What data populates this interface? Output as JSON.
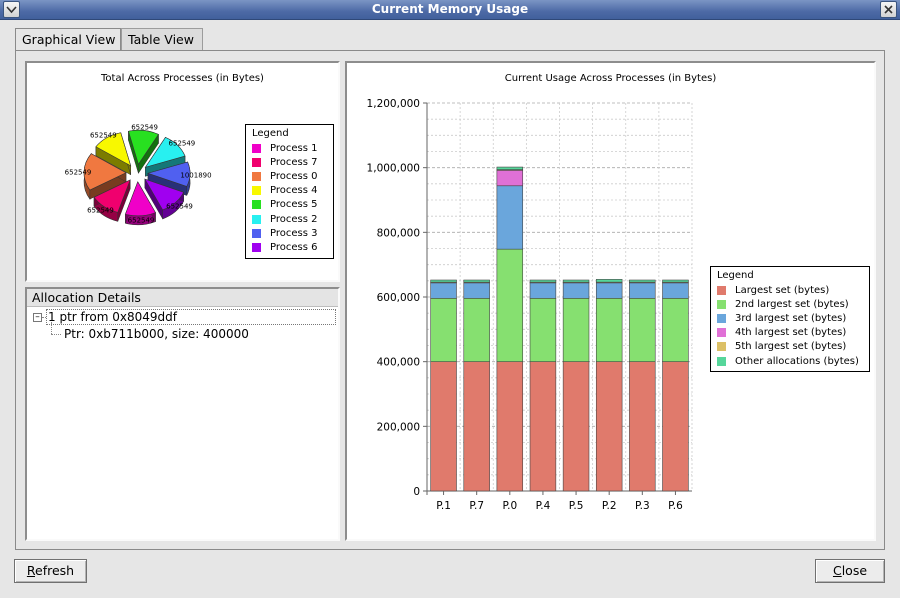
{
  "window": {
    "title": "Current Memory Usage"
  },
  "tabs": [
    {
      "label": "Graphical View",
      "active": true
    },
    {
      "label": "Table View",
      "active": false
    }
  ],
  "pie_chart": {
    "title": "Total Across Processes (in Bytes)",
    "legend_title": "Legend",
    "slice_labels": [
      "652549",
      "652549",
      "652549",
      "652549",
      "652549",
      "652549",
      "1001890",
      "652549"
    ]
  },
  "allocation_details": {
    "title": "Allocation Details",
    "expander": "–",
    "root": "1 ptr from 0x8049ddf",
    "child": "Ptr: 0xb711b000, size: 400000"
  },
  "buttons": {
    "refresh": {
      "label": "efresh",
      "mnemonic": "R"
    },
    "close": {
      "label": "lose",
      "mnemonic": "C"
    }
  },
  "chart_data": [
    {
      "type": "pie",
      "title": "Total Across Processes (in Bytes)",
      "legend_title": "Legend",
      "categories": [
        "Process 1",
        "Process 7",
        "Process 0",
        "Process 4",
        "Process 5",
        "Process 2",
        "Process 3",
        "Process 6"
      ],
      "values": [
        652549,
        652549,
        1001890,
        652549,
        652549,
        652549,
        652549,
        652549
      ],
      "colors": [
        "#f000c8",
        "#f0006e",
        "#f07840",
        "#f8f800",
        "#28e020",
        "#28f0f0",
        "#5060f0",
        "#a000f0"
      ],
      "exploded": true
    },
    {
      "type": "bar",
      "stacked": true,
      "title": "Current Usage Across Processes (in Bytes)",
      "legend_title": "Legend",
      "categories": [
        "P.1",
        "P.7",
        "P.0",
        "P.4",
        "P.5",
        "P.2",
        "P.3",
        "P.6"
      ],
      "ylim": [
        0,
        1200000
      ],
      "yticks": [
        "0",
        "200,000",
        "400,000",
        "600,000",
        "800,000",
        "1,000,000",
        "1,200,000"
      ],
      "ytick_values": [
        0,
        200000,
        400000,
        600000,
        800000,
        1000000,
        1200000
      ],
      "grid": true,
      "legend_position": "right",
      "series": [
        {
          "name": "Largest set (bytes)",
          "color": "#e07a6c",
          "values": [
            400000,
            400000,
            400000,
            400000,
            400000,
            400000,
            400000,
            400000
          ]
        },
        {
          "name": "2nd largest set (bytes)",
          "color": "#86e070",
          "values": [
            196000,
            196000,
            348000,
            196000,
            196000,
            196000,
            196000,
            196000
          ]
        },
        {
          "name": "3rd largest set (bytes)",
          "color": "#6aa6dc",
          "values": [
            48000,
            48000,
            196000,
            48000,
            48000,
            48000,
            48000,
            48000
          ]
        },
        {
          "name": "4th largest set (bytes)",
          "color": "#e070d6",
          "values": [
            0,
            0,
            48000,
            0,
            0,
            0,
            0,
            0
          ]
        },
        {
          "name": "5th largest set (bytes)",
          "color": "#dcc066",
          "values": [
            2000,
            2000,
            2000,
            2000,
            2000,
            2000,
            2000,
            2000
          ]
        },
        {
          "name": "Other allocations (bytes)",
          "color": "#56d69a",
          "values": [
            6549,
            6549,
            7890,
            6549,
            6549,
            8549,
            6549,
            6549
          ]
        }
      ]
    }
  ]
}
